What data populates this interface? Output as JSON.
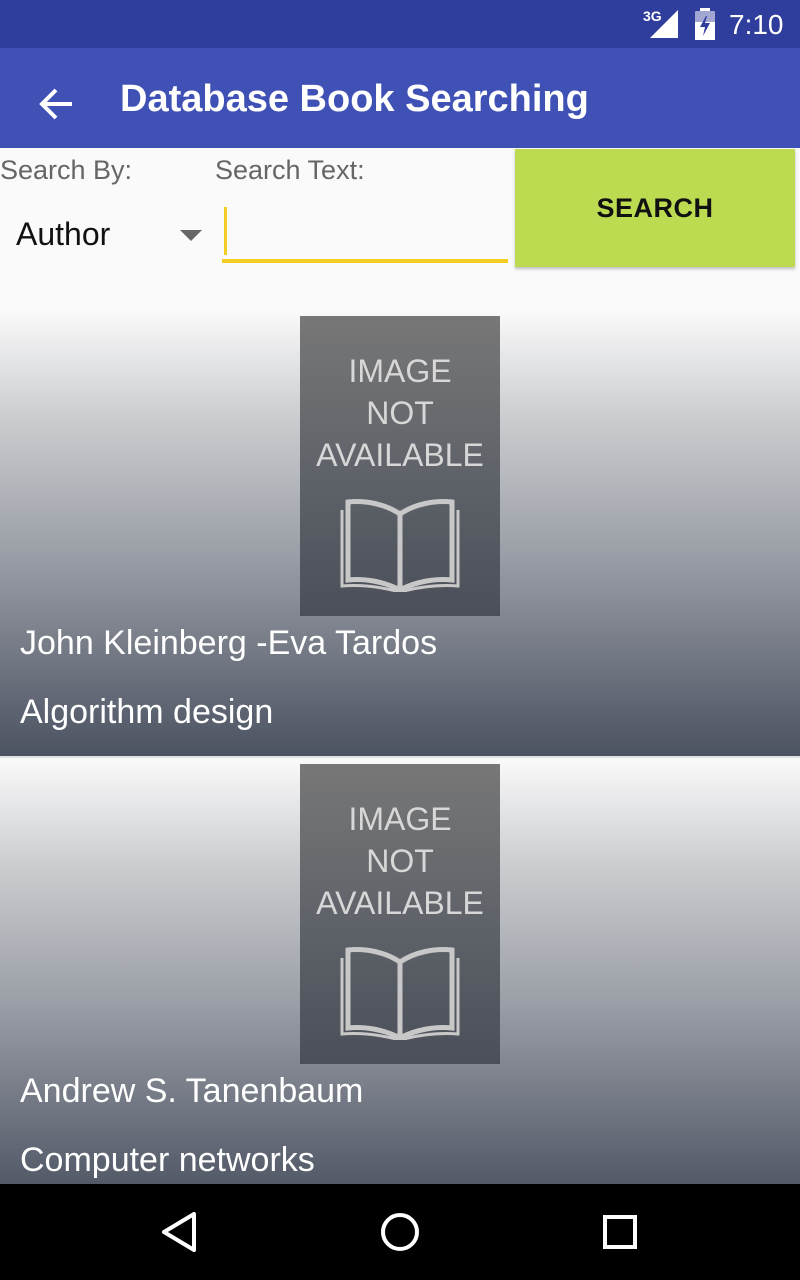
{
  "status_bar": {
    "network_label": "3G",
    "time": "7:10",
    "icons": [
      "signal-icon",
      "battery-icon"
    ]
  },
  "app_bar": {
    "back_icon": "arrow-left-icon",
    "title": "Database Book Searching",
    "color": "#3f51b5"
  },
  "search": {
    "by_label": "Search By:",
    "text_label": "Search Text:",
    "selected_field": "Author",
    "input_value": "",
    "button_label": "SEARCH",
    "button_color": "#bcdb51",
    "accent_color": "#f5ce25"
  },
  "results": [
    {
      "placeholder_text": "IMAGE NOT AVAILABLE",
      "placeholder_lines": [
        "IMAGE",
        "NOT",
        "AVAILABLE"
      ],
      "author": "John Kleinberg -Eva Tardos",
      "title": "Algorithm design"
    },
    {
      "placeholder_text": "IMAGE NOT AVAILABLE",
      "placeholder_lines": [
        "IMAGE",
        "NOT",
        "AVAILABLE"
      ],
      "author": "Andrew S. Tanenbaum",
      "title": "Computer networks"
    }
  ],
  "nav_bar": {
    "icons": [
      "back-triangle-icon",
      "home-circle-icon",
      "recents-square-icon"
    ]
  }
}
